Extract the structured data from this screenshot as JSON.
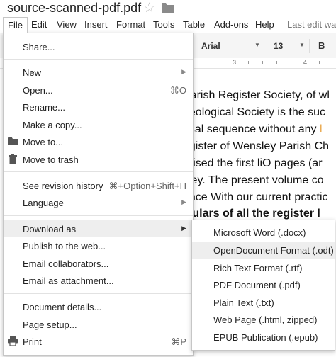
{
  "title": {
    "doc_name": "source-scanned-pdf.pdf",
    "star_icon": "star-outline-icon",
    "folder_icon": "folder-icon"
  },
  "menubar": {
    "items": [
      "File",
      "Edit",
      "View",
      "Insert",
      "Format",
      "Tools",
      "Table",
      "Add-ons",
      "Help"
    ],
    "last_edit": "Last edit was"
  },
  "toolbar": {
    "font_name": "Arial",
    "font_size": "13",
    "bold_label": "B"
  },
  "ruler": {
    "numbers": [
      "3",
      "4"
    ]
  },
  "document": {
    "lines": [
      {
        "text": "Parish Register Society, of wl",
        "bold": false
      },
      {
        "text": "aeological Society is the suc",
        "bold": false
      },
      {
        "text": "rical sequence without any ",
        "highlight": "l",
        "bold": false
      },
      {
        "text": "egister of Wensley Parish Ch",
        "bold": false
      },
      {
        "text": "prised the first liO pages (ar",
        "bold": false
      },
      {
        "text": "sley. The present volume co",
        "bold": false
      },
      {
        "text": "ance With our current practic",
        "bold": false
      },
      {
        "text": "iculars of all the register l",
        "bold": true
      }
    ]
  },
  "file_menu": {
    "share": "Share...",
    "new": "New",
    "open": "Open...",
    "open_shortcut": "⌘O",
    "rename": "Rename...",
    "make_copy": "Make a copy...",
    "move_to": "Move to...",
    "move_to_trash": "Move to trash",
    "revision_history": "See revision history",
    "revision_shortcut": "⌘+Option+Shift+H",
    "language": "Language",
    "download_as": "Download as",
    "publish": "Publish to the web...",
    "email_collaborators": "Email collaborators...",
    "email_attachment": "Email as attachment...",
    "document_details": "Document details...",
    "page_setup": "Page setup...",
    "print": "Print",
    "print_shortcut": "⌘P"
  },
  "download_submenu": {
    "items": [
      "Microsoft Word (.docx)",
      "OpenDocument Format (.odt)",
      "Rich Text Format (.rtf)",
      "PDF Document (.pdf)",
      "Plain Text (.txt)",
      "Web Page (.html, zipped)",
      "EPUB Publication (.epub)"
    ]
  }
}
